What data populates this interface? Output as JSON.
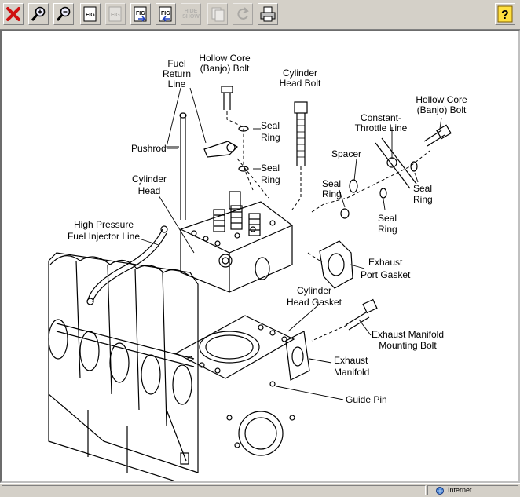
{
  "toolbar": {
    "buttons": [
      {
        "name": "close",
        "icon": "red-x-icon"
      },
      {
        "name": "zoom-in",
        "icon": "magnifier-plus-icon"
      },
      {
        "name": "zoom-out",
        "icon": "magnifier-minus-icon"
      },
      {
        "name": "fig-1",
        "icon": "fig-icon"
      },
      {
        "name": "fig-2",
        "icon": "fig-icon",
        "disabled": true
      },
      {
        "name": "fig-next",
        "icon": "fig-forward-icon"
      },
      {
        "name": "fig-prev",
        "icon": "fig-back-icon"
      },
      {
        "name": "hide-show",
        "icon": "hide-show-icon",
        "disabled": true
      },
      {
        "name": "copy",
        "icon": "copy-icon",
        "disabled": true
      },
      {
        "name": "refresh",
        "icon": "refresh-icon",
        "disabled": true
      },
      {
        "name": "print",
        "icon": "printer-icon"
      },
      {
        "name": "help",
        "icon": "help-icon"
      }
    ],
    "hide_label": "HIDE",
    "show_label": "SHOW",
    "help_label": "?"
  },
  "diagram": {
    "labels": {
      "fuel_return_line": [
        "Fuel",
        "Return",
        "Line"
      ],
      "hollow_core_bolt_1": [
        "Hollow Core",
        "(Banjo) Bolt"
      ],
      "cylinder_head_bolt": [
        "Cylinder",
        "Head Bolt"
      ],
      "hollow_core_bolt_2": [
        "Hollow Core",
        "(Banjo) Bolt"
      ],
      "constant_throttle_line": [
        "Constant-",
        "Throttle Line"
      ],
      "seal_ring_1": [
        "Seal",
        "Ring"
      ],
      "seal_ring_2": [
        "Seal",
        "Ring"
      ],
      "pushrod": [
        "Pushrod"
      ],
      "spacer": [
        "Spacer"
      ],
      "seal_ring_3": [
        "Seal",
        "Ring"
      ],
      "seal_ring_4": [
        "Seal",
        "Ring"
      ],
      "seal_ring_5": [
        "Seal",
        "Ring"
      ],
      "cylinder_head": [
        "Cylinder",
        "Head"
      ],
      "high_pressure_line": [
        "High Pressure",
        "Fuel Injector Line"
      ],
      "exhaust_port_gasket": [
        "Exhaust",
        "Port Gasket"
      ],
      "cylinder_head_gasket": [
        "Cylinder",
        "Head Gasket"
      ],
      "exhaust_manifold_bolt": [
        "Exhaust Manifold",
        "Mounting Bolt"
      ],
      "exhaust_manifold": [
        "Exhaust",
        "Manifold"
      ],
      "guide_pin": [
        "Guide Pin"
      ]
    }
  },
  "statusbar": {
    "zone_label": "Internet"
  }
}
